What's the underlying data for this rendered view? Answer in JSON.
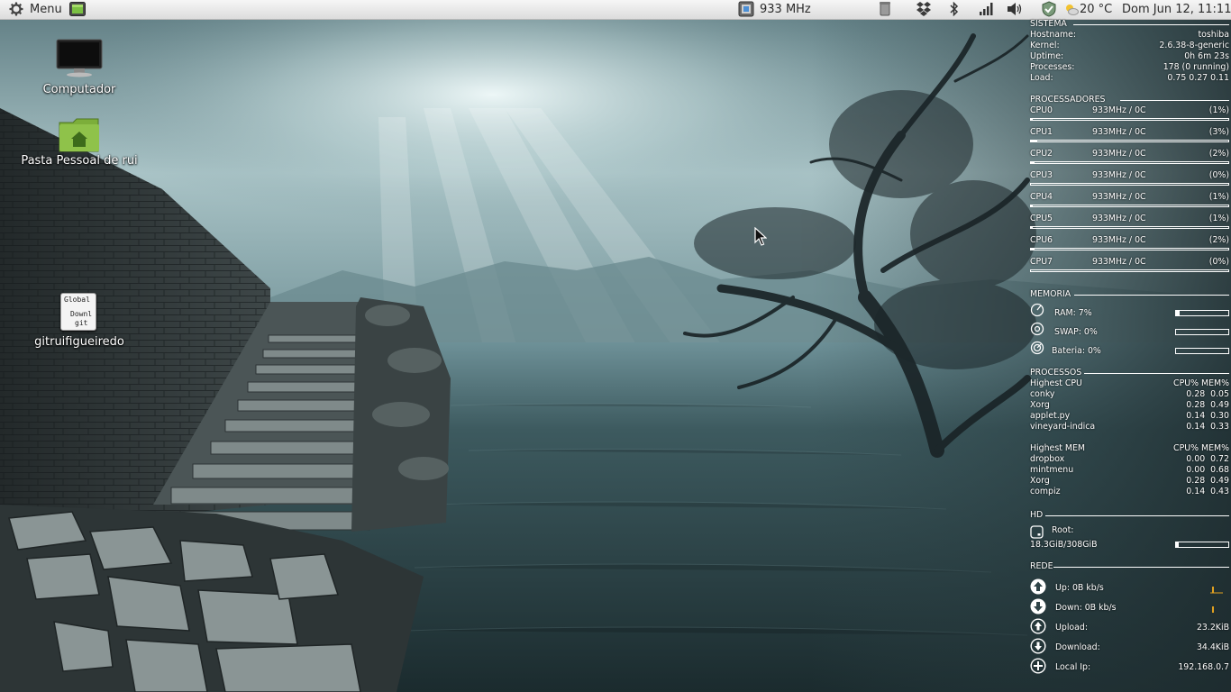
{
  "panel": {
    "menu_label": "Menu",
    "cpu_freq": "933 MHz",
    "weather": "20 °C",
    "clock": "Dom Jun 12, 11:11",
    "icons": [
      "gear-icon",
      "terminal-applet-icon",
      "cpufreq-icon",
      "trash-icon",
      "dropbox-icon",
      "bluetooth-icon",
      "network-signal-icon",
      "volume-icon",
      "update-shield-icon",
      "weather-icon"
    ]
  },
  "desktop": {
    "icons": [
      {
        "label": "Computador",
        "icon": "monitor-icon"
      },
      {
        "label": "Pasta Pessoal de rui",
        "icon": "home-folder-icon"
      },
      {
        "label": "gitruifigueiredo",
        "icon": "text-file-icon",
        "file_lines": [
          "Global",
          "Downl",
          "git"
        ]
      }
    ]
  },
  "conky": {
    "sistema": {
      "title": "SISTEMA",
      "rows": [
        {
          "label": "Hostname:",
          "value": "toshiba"
        },
        {
          "label": "Kernel:",
          "value": "2.6.38-8-generic"
        },
        {
          "label": "Uptime:",
          "value": "0h 6m 23s"
        },
        {
          "label": "Processes:",
          "value": "178 (0 running)"
        },
        {
          "label": "Load:",
          "value": "0.75 0.27 0.11"
        }
      ]
    },
    "processadores": {
      "title": "PROCESSADORES",
      "cpus": [
        {
          "name": "CPU0",
          "freq": "933MHz / 0C",
          "usage": "(1%)",
          "pct": 1
        },
        {
          "name": "CPU1",
          "freq": "933MHz / 0C",
          "usage": "(3%)",
          "pct": 3
        },
        {
          "name": "CPU2",
          "freq": "933MHz / 0C",
          "usage": "(2%)",
          "pct": 2
        },
        {
          "name": "CPU3",
          "freq": "933MHz / 0C",
          "usage": "(0%)",
          "pct": 0
        },
        {
          "name": "CPU4",
          "freq": "933MHz / 0C",
          "usage": "(1%)",
          "pct": 1
        },
        {
          "name": "CPU5",
          "freq": "933MHz / 0C",
          "usage": "(1%)",
          "pct": 1
        },
        {
          "name": "CPU6",
          "freq": "933MHz / 0C",
          "usage": "(2%)",
          "pct": 2
        },
        {
          "name": "CPU7",
          "freq": "933MHz / 0C",
          "usage": "(0%)",
          "pct": 0
        }
      ]
    },
    "memoria": {
      "title": "MEMORIA",
      "ram": "RAM: 7%",
      "ram_pct": 7,
      "swap": "SWAP: 0%",
      "swap_pct": 0,
      "bateria": "Bateria: 0%",
      "bateria_pct": 0
    },
    "processos": {
      "title": "PROCESSOS",
      "cpu_header": "Highest CPU",
      "cols": "CPU% MEM%",
      "cpu_list": [
        {
          "name": "conky",
          "vals": "0.28  0.05"
        },
        {
          "name": "Xorg",
          "vals": "0.28  0.49"
        },
        {
          "name": "applet.py",
          "vals": "0.14  0.30"
        },
        {
          "name": "vineyard-indica",
          "vals": "0.14  0.33"
        }
      ],
      "mem_header": "Highest MEM",
      "mem_list": [
        {
          "name": "dropbox",
          "vals": "0.00  0.72"
        },
        {
          "name": "mintmenu",
          "vals": "0.00  0.68"
        },
        {
          "name": "Xorg",
          "vals": "0.28  0.49"
        },
        {
          "name": "compiz",
          "vals": "0.14  0.43"
        }
      ]
    },
    "hd": {
      "title": "HD",
      "root_label": "Root:",
      "root_usage": "18.3GiB/308GiB",
      "root_pct": 6
    },
    "rede": {
      "title": "REDE",
      "up": "Up: 0B   kb/s",
      "down": "Down: 0B   kb/s",
      "upload_label": "Upload:",
      "upload_value": "23.2KiB",
      "download_label": "Download:",
      "download_value": "34.4KiB",
      "localip_label": "Local Ip:",
      "localip_value": "192.168.0.7"
    }
  }
}
